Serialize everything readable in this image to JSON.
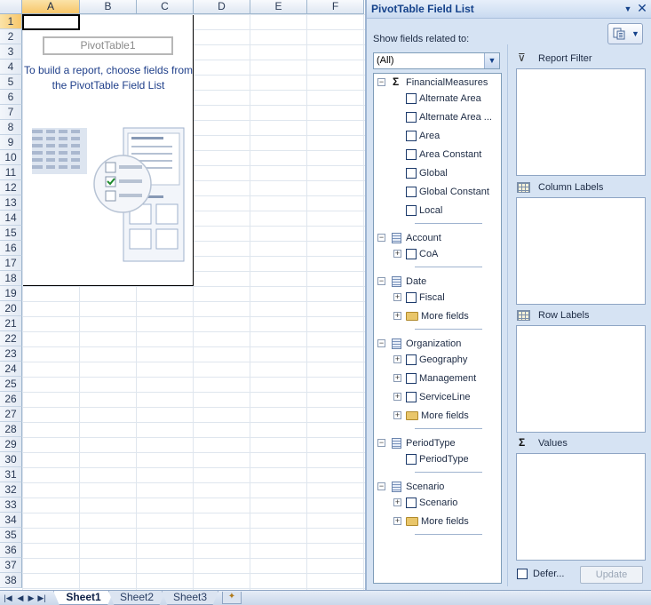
{
  "sheet": {
    "columns": [
      "A",
      "B",
      "C",
      "D",
      "E",
      "F"
    ],
    "selected_column": "A",
    "rows": [
      "1",
      "2",
      "3",
      "4",
      "5",
      "6",
      "7",
      "8",
      "9",
      "10",
      "11",
      "12",
      "13",
      "14",
      "15",
      "16",
      "17",
      "18",
      "19",
      "20",
      "21",
      "22",
      "23",
      "24",
      "25",
      "26",
      "27",
      "28",
      "29",
      "30",
      "31",
      "32",
      "33",
      "34",
      "35",
      "36",
      "37",
      "38"
    ],
    "selected_row": "1",
    "pivot": {
      "name": "PivotTable1",
      "hint": "To build a report, choose fields from the PivotTable Field List"
    },
    "tabs": [
      "Sheet1",
      "Sheet2",
      "Sheet3"
    ],
    "active_tab": "Sheet1"
  },
  "pane": {
    "title": "PivotTable Field List",
    "show_fields_label": "Show fields related to:",
    "combo_value": "(All)",
    "groups": [
      {
        "name": "FinancialMeasures",
        "icon": "sigma-icon",
        "items": [
          {
            "label": "Alternate Area",
            "expandable": false,
            "folder": false
          },
          {
            "label": "Alternate Area ...",
            "expandable": false,
            "folder": false
          },
          {
            "label": "Area",
            "expandable": false,
            "folder": false
          },
          {
            "label": "Area Constant",
            "expandable": false,
            "folder": false
          },
          {
            "label": "Global",
            "expandable": false,
            "folder": false
          },
          {
            "label": "Global Constant",
            "expandable": false,
            "folder": false
          },
          {
            "label": "Local",
            "expandable": false,
            "folder": false
          }
        ]
      },
      {
        "name": "Account",
        "icon": "table-icon",
        "items": [
          {
            "label": "CoA",
            "expandable": true,
            "folder": false
          }
        ]
      },
      {
        "name": "Date",
        "icon": "table-icon",
        "items": [
          {
            "label": "Fiscal",
            "expandable": true,
            "folder": false
          },
          {
            "label": "More fields",
            "expandable": true,
            "folder": true
          }
        ]
      },
      {
        "name": "Organization",
        "icon": "table-icon",
        "items": [
          {
            "label": "Geography",
            "expandable": true,
            "folder": false
          },
          {
            "label": "Management",
            "expandable": true,
            "folder": false
          },
          {
            "label": "ServiceLine",
            "expandable": true,
            "folder": false
          },
          {
            "label": "More fields",
            "expandable": true,
            "folder": true
          }
        ]
      },
      {
        "name": "PeriodType",
        "icon": "table-icon",
        "items": [
          {
            "label": "PeriodType",
            "expandable": false,
            "folder": false
          }
        ]
      },
      {
        "name": "Scenario",
        "icon": "table-icon",
        "items": [
          {
            "label": "Scenario",
            "expandable": true,
            "folder": false
          },
          {
            "label": "More fields",
            "expandable": true,
            "folder": true
          }
        ]
      }
    ],
    "areas": {
      "report_filter": "Report Filter",
      "column_labels": "Column Labels",
      "row_labels": "Row Labels",
      "values": "Values"
    },
    "defer_label": "Defer...",
    "update_label": "Update"
  }
}
